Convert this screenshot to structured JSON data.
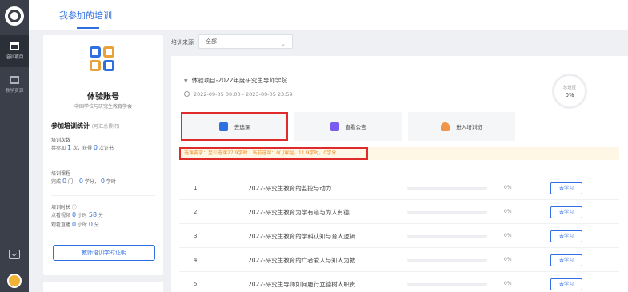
{
  "sidebar": {
    "items": [
      {
        "label": "培训项目",
        "active": true
      },
      {
        "label": "教学资源",
        "active": false
      }
    ]
  },
  "header": {
    "tab_label": "我参加的培训"
  },
  "profile": {
    "name": "体验账号",
    "org": "中国学位与研究生教育学会",
    "stats_title": "参加培训统计",
    "stats_note": "(可汇总累积)",
    "count_label": "培训次数",
    "count_line_prefix": "共参加",
    "count_joined": "1",
    "count_mid": "次，获得",
    "count_certs": "0",
    "count_suffix": "次证书",
    "course_label": "培训课程",
    "course_line_prefix": "完成",
    "course_done": "0",
    "course_mid": "门，",
    "course_credits": "0",
    "course_mid2": "学分，",
    "course_hours": "0",
    "course_suffix": "学时",
    "time_label": "培训时长 ⓘ",
    "watch_prefix": "点看视频",
    "watch_hours": "0",
    "watch_mid": "小时",
    "watch_minutes": "58",
    "watch_suffix": "分",
    "live_prefix": "观看直播",
    "live_hours": "0",
    "live_mid": "小时",
    "live_minutes": "0",
    "live_suffix": "分",
    "cta_label": "教师培训学时证明"
  },
  "filter": {
    "label": "培训来源",
    "selected": "全部"
  },
  "project": {
    "title": "体验项目-2022年度研究生导师学院",
    "date_range": "2022-09-05 00:00 - 2023-09-05 23:59",
    "progress_label": "总进度",
    "progress_value": "0%",
    "actions": [
      {
        "label": "去选课",
        "icon": "course-select-icon",
        "selected": true
      },
      {
        "label": "查看公告",
        "icon": "notice-icon",
        "selected": false
      },
      {
        "label": "进入培训班",
        "icon": "class-enter-icon",
        "selected": false
      }
    ],
    "requirement": "选课要求：至少选课27.9学时 | 当前选课：0门课程，11.9学时，0学分"
  },
  "courses": [
    {
      "num": "1",
      "title": "2022-研究生教育的监控与动力",
      "progress": 0,
      "pct": "0%",
      "button": "去学习"
    },
    {
      "num": "2",
      "title": "2022-研究生教育为学有道与为人有德",
      "progress": 0,
      "pct": "0%",
      "button": "去学习"
    },
    {
      "num": "3",
      "title": "2022-研究生教育的学科认知与育人逻辑",
      "progress": 0,
      "pct": "0%",
      "button": "去学习"
    },
    {
      "num": "4",
      "title": "2022-研究生教育的广者爱人与知人为教",
      "progress": 0,
      "pct": "0%",
      "button": "去学习"
    },
    {
      "num": "5",
      "title": "2022-研究生导师如何履行立德树人职责",
      "progress": 0,
      "pct": "0%",
      "button": "去学习"
    }
  ],
  "colors": {
    "accent": "#2f6fe0",
    "rail": "#3a3f4a",
    "highlight": "#e02b2b",
    "warning_text": "#f08a1c"
  }
}
